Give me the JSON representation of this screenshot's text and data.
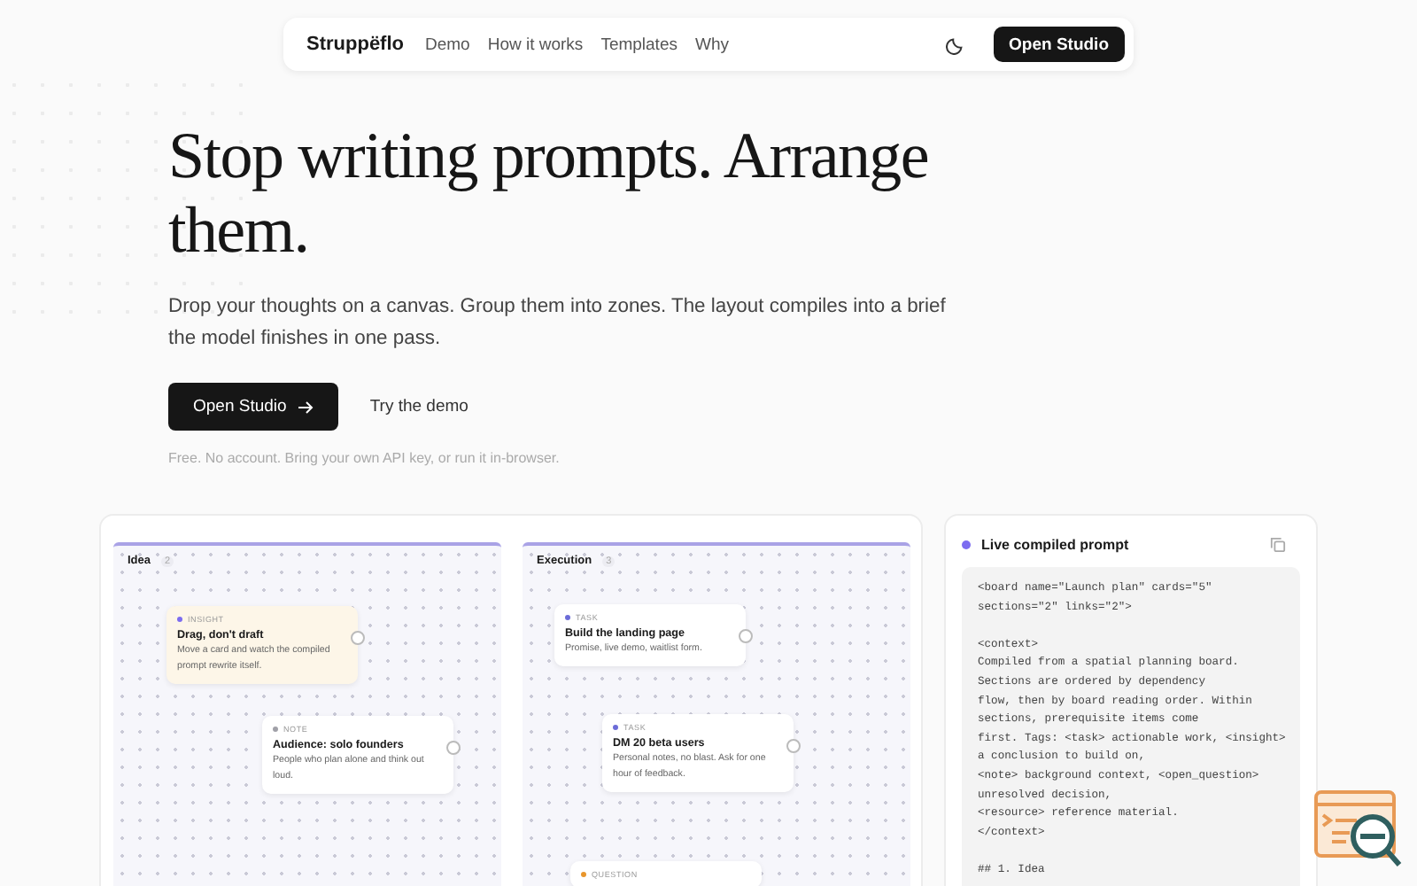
{
  "nav": {
    "brand": "Struppëflo",
    "links": [
      "Demo",
      "How it works",
      "Templates",
      "Why"
    ],
    "cta": "Open Studio"
  },
  "hero": {
    "title": "Stop writing prompts. Arrange them.",
    "subtitle": "Drop your thoughts on a canvas. Group them into zones. The layout compiles into a brief the model finishes in one pass.",
    "primary": "Open Studio",
    "secondary": "Try the demo",
    "note": "Free. No account. Bring your own API key, or run it in-browser."
  },
  "canvas": {
    "zones": [
      {
        "name": "Idea",
        "count": "2",
        "cards": [
          {
            "kind": "insight",
            "color": "#7c6cf0",
            "tag": "INSIGHT",
            "title": "Drag, don't draft",
            "body": "Move a card and watch the compiled prompt rewrite itself."
          },
          {
            "kind": "note",
            "color": "#a0a0a8",
            "tag": "NOTE",
            "title": "Audience: solo founders",
            "body": "People who plan alone and think out loud."
          }
        ]
      },
      {
        "name": "Execution",
        "count": "3",
        "cards": [
          {
            "kind": "task",
            "color": "#6c6cd8",
            "tag": "TASK",
            "title": "Build the landing page",
            "body": "Promise, live demo, waitlist form."
          },
          {
            "kind": "task",
            "color": "#6c6cd8",
            "tag": "TASK",
            "title": "DM 20 beta users",
            "body": "Personal notes, no blast. Ask for one hour of feedback."
          },
          {
            "kind": "question",
            "color": "#e8962c",
            "tag": "QUESTION"
          }
        ]
      }
    ]
  },
  "prompt": {
    "title": "Live compiled prompt",
    "code": "<board name=\"Launch plan\" cards=\"5\"\nsections=\"2\" links=\"2\">\n\n<context>\nCompiled from a spatial planning board.\nSections are ordered by dependency\nflow, then by board reading order. Within\nsections, prerequisite items come\nfirst. Tags: <task> actionable work, <insight>\na conclusion to build on,\n<note> background context, <open_question>\nunresolved decision,\n<resource> reference material.\n</context>\n\n## 1. Idea"
  }
}
